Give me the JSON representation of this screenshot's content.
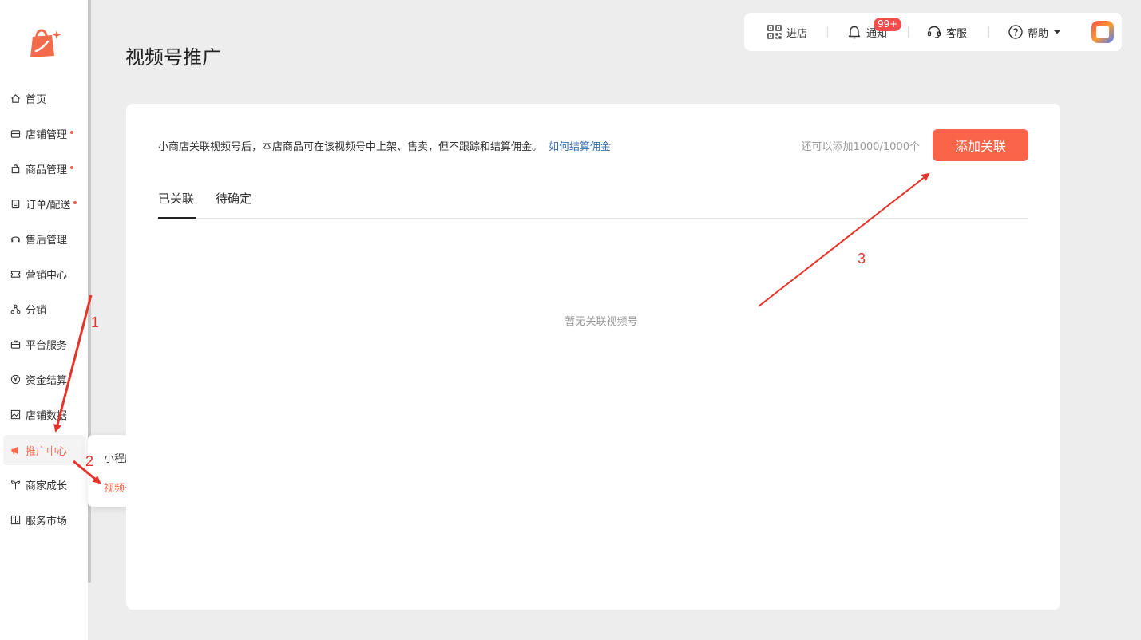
{
  "sidebar": {
    "items": [
      {
        "label": "首页",
        "icon": "home-icon",
        "dot": false
      },
      {
        "label": "店铺管理",
        "icon": "store-icon",
        "dot": true
      },
      {
        "label": "商品管理",
        "icon": "bag-icon",
        "dot": true
      },
      {
        "label": "订单/配送",
        "icon": "clipboard-icon",
        "dot": true
      },
      {
        "label": "售后管理",
        "icon": "headset-icon",
        "dot": false
      },
      {
        "label": "营销中心",
        "icon": "ticket-icon",
        "dot": false
      },
      {
        "label": "分销",
        "icon": "network-icon",
        "dot": false
      },
      {
        "label": "平台服务",
        "icon": "briefcase-icon",
        "dot": false
      },
      {
        "label": "资金结算",
        "icon": "yen-icon",
        "dot": false
      },
      {
        "label": "店铺数据",
        "icon": "chart-icon",
        "dot": false
      },
      {
        "label": "推广中心",
        "icon": "megaphone-icon",
        "dot": false,
        "active": true
      },
      {
        "label": "商家成长",
        "icon": "sprout-icon",
        "dot": false
      },
      {
        "label": "服务市场",
        "icon": "grid-store-icon",
        "dot": false
      }
    ],
    "submenu": [
      {
        "label": "小程序联盟",
        "active": false
      },
      {
        "label": "视频号推广",
        "active": true
      }
    ]
  },
  "header": {
    "title": "视频号推广",
    "topbar": {
      "enter_store": "进店",
      "notify": "通知",
      "notify_badge": "99+",
      "service": "客服",
      "help": "帮助"
    }
  },
  "main": {
    "intro": "小商店关联视频号后，本店商品可在该视频号中上架、售卖，但不跟踪和结算佣金。",
    "intro_link": "如何结算佣金",
    "quota": "还可以添加1000/1000个",
    "add_button": "添加关联",
    "tabs": [
      {
        "label": "已关联",
        "active": true
      },
      {
        "label": "待确定",
        "active": false
      }
    ],
    "empty_text": "暂无关联视频号"
  },
  "annotations": {
    "step1": "1",
    "step2": "2",
    "step3": "3"
  },
  "colors": {
    "accent": "#fa6448",
    "link": "#3d6fa8",
    "arrow": "#e6332a",
    "badge": "#f04d4d"
  }
}
